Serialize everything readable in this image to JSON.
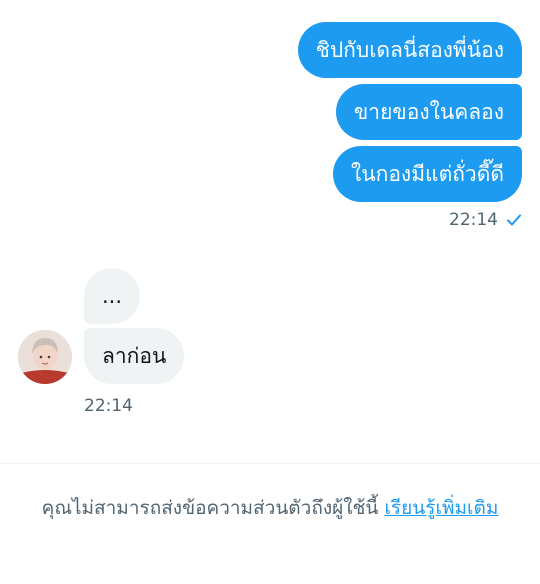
{
  "conversation": {
    "sent_messages": [
      {
        "text": "ชิปกับเดลนี่สองพี่น้อง"
      },
      {
        "text": "ขายของในคลอง"
      },
      {
        "text": "ในกองมีแต่ถั่วดี๊ดี"
      }
    ],
    "sent_time": "22:14",
    "received_messages": [
      {
        "text": "..."
      },
      {
        "text": "ลาก่อน"
      }
    ],
    "received_time": "22:14"
  },
  "footer": {
    "notice": "คุณไม่สามารถส่งข้อความส่วนตัวถึงผู้ใช้นี้ ",
    "learn_more": "เรียนรู้เพิ่มเติม"
  },
  "colors": {
    "accent": "#1d9bf0",
    "received_bubble": "#eff3f4",
    "muted_text": "#536471"
  },
  "icons": {
    "read_receipt": "check-icon"
  }
}
